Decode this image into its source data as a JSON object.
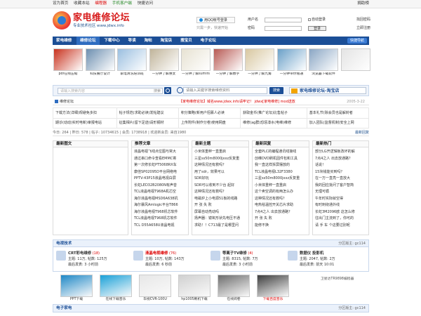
{
  "topbar": {
    "left": [
      "设为首页",
      "收藏本站",
      "编程器",
      "手机客户端",
      "快捷访问"
    ],
    "right": "捐助榜"
  },
  "logo": {
    "title": "家电维修论坛",
    "subtitle": "专业技术社区 www.jdwx.info"
  },
  "qq": {
    "label": "用QQ帐号登录",
    "sub": "只需一步，快速开始"
  },
  "login": {
    "user_label": "用户名",
    "pass_label": "密码",
    "auto_label": "自动登录",
    "btn": "登录",
    "find_pass": "找回密码",
    "register": "立即注册"
  },
  "nav": {
    "items": [
      "家电维修",
      "维修论坛",
      "下载中心",
      "导读",
      "淘帖",
      "淘宝店",
      "搜宝贝",
      "电子论坛"
    ],
    "quick": "快捷导航"
  },
  "thumbs": [
    {
      "cap": "pdf在线压缩",
      "color": "#c8321e"
    },
    {
      "cap": "科技展厅设计",
      "color": "#6d8fb0"
    },
    {
      "cap": "家电清洗培训班",
      "color": "#9bbfe0"
    },
    {
      "cap": "一分钟了解惠女",
      "color": "#c0b49a"
    },
    {
      "cap": "一分钟了解sumifs",
      "color": "#e7e2d2"
    },
    {
      "cap": "一分钟了解数字",
      "color": "#b85a54"
    },
    {
      "cap": "一分钟了解九角",
      "color": "#d8c7a0"
    },
    {
      "cap": "一分钟带你看通",
      "color": "#6aa0c8"
    },
    {
      "cap": "浏览器下载软件",
      "color": "#8aa6c4"
    },
    {
      "cap": "",
      "color": "#e4e4e4"
    }
  ],
  "search": {
    "left_placeholder": "请输入搜索内容",
    "left_select": "搜索",
    "right_placeholder": "请输入关键字搜索维修资料",
    "right_btn": "搜索",
    "mall": "家电维修论坛-淘宝店"
  },
  "ticker": {
    "category": "维修论坛",
    "text": "【家电维修论坛】域名www.jdwx.info请牢记！ jdwx[家电维修] mod送放",
    "date": "2005-3-22"
  },
  "links": [
    [
      "下载方法(详细)规避免多扣",
      "帖子规范(求助必读)发帖建议",
      "积分策略(新用户招募人必读",
      "获取金币(推广论坛)比售帖子",
      "基本礼节(除会员也是解封者"
    ],
    [
      "期诊(动动)实时电新)审报电站",
      "征集相片(留下足迹)请形钢材",
      "上传附件(制作分卷)使用网盘",
      "维修(ag群)恐惩漆水(电维)维修",
      "加入团队(监督机制)安全上网"
    ]
  ],
  "stats": {
    "text": "今日: 264 | 昨日: 578 | 帖子: 10734615 | 会员: 1738918 | 欢迎新会员: 来自1980",
    "right": "最新回复"
  },
  "columns": [
    {
      "title": "最新图文",
      "lines": []
    },
    {
      "title": "推荐文章",
      "lines": [
        "液晶电视飞线点位图与常大",
        "通过串口命令查看EMMC寄",
        "第一次修长虹PT5068RX车",
        "康佳SP02095D平台网络电",
        "PPTV-43P15液晶电视白屏",
        "长虹LED32B2080N有声音",
        "TCL液晶电视T968A机芯空",
        "海尔液晶电视MSD6A638机",
        "海尔暴风Amlogic平台T866",
        "海尔液晶电视T968机芯软件",
        "TCL液晶电视T968机芯软件",
        "TCL D55A658U液晶电视"
      ]
    },
    {
      "title": "最新主题",
      "lines": [
        "小米体重秤一直重启",
        "三星ss50m8000jxxz反复重",
        "这种情况还有救吗？",
        "用了sdr，效果可以",
        "SDR好玩",
        "SDR可以收到不少台 起好",
        "这种情况还有救吗？",
        "电磁炉上小电源51板的线路",
        "开 张 失 败",
        "屏幕自动亮动吗",
        "扬声器：镜氧形状先电压不通",
        "求助！！C713最了是哪里问"
      ]
    },
    {
      "title": "最新回复",
      "lines": [
        "全套PLC的编程通讯线接线",
        "创维DVD刷机固件包和工具",
        "我一直这样拆屏摆放的",
        "TCL液晶电视L32F3380",
        "三星ss50m8000jxxz反复重",
        "小米体重秤一直重启",
        "这个卖空调的有两怎么办",
        "这种情况还有救吗？",
        "电热毯温控开关芯片求助",
        "7点4之人 出去放通路？",
        "开 张 失 败",
        "能修不换"
      ]
    },
    {
      "title": "最新热门",
      "lines": [
        "部分LG开逻辑板改坏的解",
        "7点4之人 出去放通路？",
        "话说！",
        "15块钱能买到吗？",
        "在一万一直亮一直放大",
        "我的回应批问了客户智简",
        "无理可循",
        "午年时实际就空得",
        "有时刺绕通外线",
        "长虹3M2096欧 这怎么修",
        "往出门主流到了，你可的",
        "请 手 车  个这要过别呢"
      ]
    }
  ],
  "forum": {
    "title": "电视技术",
    "right": "分区版主: gc114",
    "items": [
      {
        "name": "CRT彩电维修",
        "badge": "(18)",
        "l1": "主题: 11万, 帖数: 125万",
        "l2": "最后发表: 3 小时前"
      },
      {
        "name": "液晶电视维修",
        "badge": "(76)",
        "l1": "主题: 10万, 帖数: 143万",
        "l2": "最后发表: 6 秒前"
      },
      {
        "name": "等离子TV维修",
        "badge": "(4)",
        "l1": "主题: 8315, 帖数: 7万",
        "l2": "最后发表: 3 小时前"
      },
      {
        "name": "数据仪 投影机",
        "badge": "",
        "l1": "主题: 2047, 帖数: 2万",
        "l2": "最后发表: 前天 10:01"
      }
    ]
  },
  "gallery": [
    {
      "cap": "PPT下载",
      "color": "#1e88c6"
    },
    {
      "cap": "在线下载音乐",
      "color": "#1aa1d8"
    },
    {
      "cap": "华视CVR-100U",
      "color": "#e7e7e7"
    },
    {
      "cap": "hp1005刷机下载",
      "color": "#d0d0d0"
    },
    {
      "cap": "在线阅卷",
      "color": "#6d6d6d"
    },
    {
      "cap": "下载百度音乐",
      "color": "#3d3d3d"
    }
  ],
  "gallery_side": "卫星达TR9898编程器",
  "footbar": {
    "title": "电子家电",
    "right": "分区版主: gc114"
  }
}
